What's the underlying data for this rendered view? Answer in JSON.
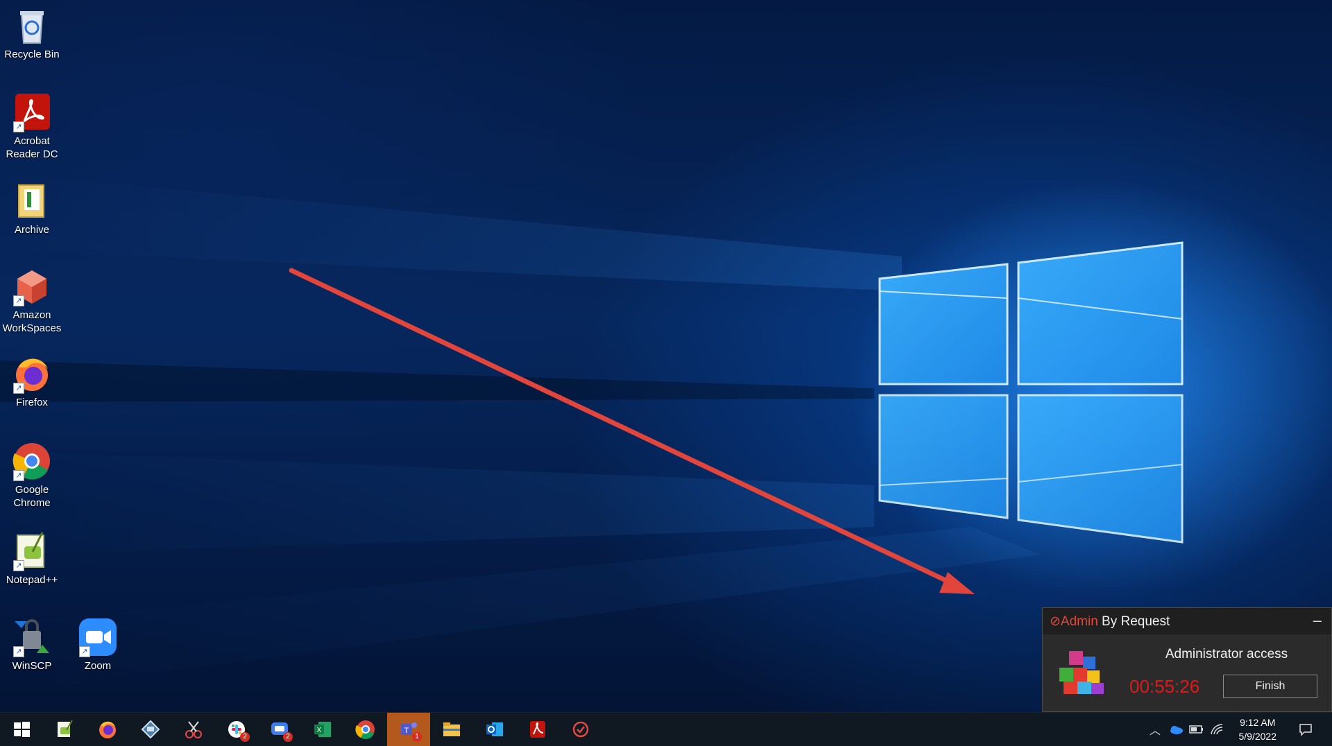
{
  "desktop": {
    "icons": [
      {
        "label": "Recycle Bin",
        "icon": "recycle-bin-icon"
      },
      {
        "label": "Acrobat Reader DC",
        "icon": "acrobat-icon"
      },
      {
        "label": "Archive",
        "icon": "folder-icon"
      },
      {
        "label": "Amazon WorkSpaces",
        "icon": "amazon-workspaces-icon"
      },
      {
        "label": "Firefox",
        "icon": "firefox-icon"
      },
      {
        "label": "Google Chrome",
        "icon": "chrome-icon"
      },
      {
        "label": "Notepad++",
        "icon": "notepadpp-icon"
      },
      {
        "label": "WinSCP",
        "icon": "winscp-icon"
      },
      {
        "label": "Zoom",
        "icon": "zoom-icon"
      }
    ]
  },
  "admin_by_request": {
    "brand_part1": "Admin",
    "brand_part2": " By Request",
    "minimize_label": "–",
    "title": "Administrator access",
    "timer": "00:55:26",
    "finish_label": "Finish",
    "colors": {
      "brand_red": "#e34a3f",
      "timer_red": "#e01818"
    }
  },
  "taskbar": {
    "apps": [
      {
        "icon": "windows-start-icon"
      },
      {
        "icon": "notepadpp-icon"
      },
      {
        "icon": "firefox-icon"
      },
      {
        "icon": "remote-desktop-icon"
      },
      {
        "icon": "snipping-tool-icon"
      },
      {
        "icon": "slack-icon",
        "badge": "2"
      },
      {
        "icon": "teams-chat-icon",
        "badge": "2"
      },
      {
        "icon": "excel-icon"
      },
      {
        "icon": "chrome-icon"
      },
      {
        "icon": "teams-icon",
        "badge": "1",
        "active": true
      },
      {
        "icon": "file-explorer-icon"
      },
      {
        "icon": "outlook-icon"
      },
      {
        "icon": "acrobat-icon"
      },
      {
        "icon": "admin-by-request-icon"
      }
    ],
    "tray": {
      "time": "9:12 AM",
      "date": "5/9/2022"
    }
  }
}
